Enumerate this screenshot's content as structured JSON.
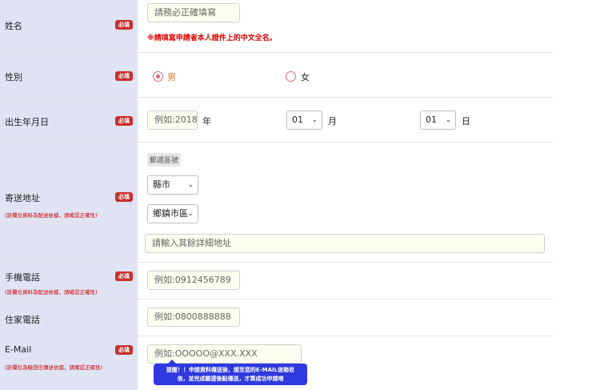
{
  "required_badge": "必填",
  "name": {
    "label": "姓名",
    "placeholder": "請務必正確填寫",
    "warning": "※請填寫申請者本人證件上的中文全名。"
  },
  "gender": {
    "label": "性別",
    "option_male": "男",
    "option_female": "女",
    "selected": "男"
  },
  "birthday": {
    "label": "出生年月日",
    "year_placeholder": "例如:2018",
    "year_unit": "年",
    "month_value": "01",
    "month_unit": "月",
    "day_value": "01",
    "day_unit": "日"
  },
  "address": {
    "label": "寄送地址",
    "note": "(該欄位資料為配送依據，請確認正確性)",
    "zip_label": "郵遞區號",
    "city_value": "縣市",
    "district_value": "鄉鎮市區",
    "detail_placeholder": "請輸入其餘詳細地址"
  },
  "mobile": {
    "label": "手機電話",
    "note": "(該欄位資料為配送依據，請確認正確性)",
    "placeholder": "例如:0912456789"
  },
  "home_phone": {
    "label": "住家電話",
    "placeholder": "例如:0800888888"
  },
  "email": {
    "label": "E-Mail",
    "note": "(該欄位為驗證信傳送依據，請確認正確性)",
    "placeholder": "例如:OOOOO@XXX.XXX",
    "tooltip_line1": "提醒！！申請資料傳送後，請至您的E-MAIL信箱收",
    "tooltip_line2": "信，並完成驗證後點傳送，才算成功申請唷"
  },
  "colors": {
    "label_bg": "#dfe3f4",
    "required": "#c9302c",
    "warning": "#dd0000",
    "tooltip": "#2f39e0",
    "input_bg": "#fdfdf0"
  }
}
